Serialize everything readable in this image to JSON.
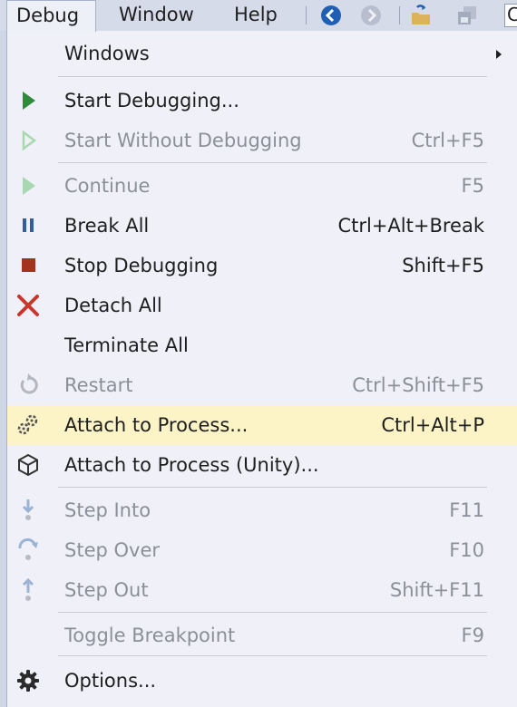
{
  "menubar": {
    "items": [
      "Debug",
      "Window",
      "Help"
    ],
    "toolbar_icons": [
      "navigate-back-icon",
      "navigate-forward-icon",
      "new-folder-icon",
      "save-all-icon"
    ],
    "partial_box_text": "C"
  },
  "menu": {
    "windows": {
      "label": "Windows",
      "submenu": true
    },
    "start_debugging": {
      "label": "Start Debugging...",
      "shortcut": "",
      "enabled": true
    },
    "start_without_debugging": {
      "label": "Start Without Debugging",
      "shortcut": "Ctrl+F5",
      "enabled": false
    },
    "continue": {
      "label": "Continue",
      "shortcut": "F5",
      "enabled": false
    },
    "break_all": {
      "label": "Break All",
      "shortcut": "Ctrl+Alt+Break",
      "enabled": true
    },
    "stop_debugging": {
      "label": "Stop Debugging",
      "shortcut": "Shift+F5",
      "enabled": true
    },
    "detach_all": {
      "label": "Detach All",
      "shortcut": "",
      "enabled": true
    },
    "terminate_all": {
      "label": "Terminate All",
      "shortcut": "",
      "enabled": true
    },
    "restart": {
      "label": "Restart",
      "shortcut": "Ctrl+Shift+F5",
      "enabled": false
    },
    "attach_to_process": {
      "label": "Attach to Process...",
      "shortcut": "Ctrl+Alt+P",
      "enabled": true,
      "highlighted": true
    },
    "attach_unity": {
      "label": "Attach to Process (Unity)...",
      "shortcut": "",
      "enabled": true
    },
    "step_into": {
      "label": "Step Into",
      "shortcut": "F11",
      "enabled": false
    },
    "step_over": {
      "label": "Step Over",
      "shortcut": "F10",
      "enabled": false
    },
    "step_out": {
      "label": "Step Out",
      "shortcut": "Shift+F11",
      "enabled": false
    },
    "toggle_breakpoint": {
      "label": "Toggle Breakpoint",
      "shortcut": "F9",
      "enabled": false
    },
    "options": {
      "label": "Options...",
      "shortcut": "",
      "enabled": true
    }
  },
  "colors": {
    "play_green": "#2e8b3a",
    "disabled_green": "#a8d8b0",
    "pause_blue": "#2f5ea8",
    "stop_red": "#a5321f",
    "detach_red": "#c8372d",
    "highlight": "#fcf4c6"
  }
}
